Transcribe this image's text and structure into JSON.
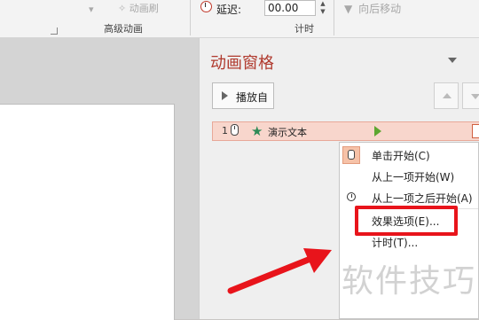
{
  "ribbon": {
    "animation_brush": "动画刷",
    "advanced_animation_group": "高级动画",
    "delay_label": "延迟:",
    "delay_value": "00.00",
    "move_later": "向后移动",
    "timing_group": "计时"
  },
  "pane": {
    "title": "动画窗格",
    "play_from": "播放自",
    "item": {
      "number": "1",
      "name": "演示文本"
    }
  },
  "context_menu": {
    "items": [
      {
        "label": "单击开始(C)",
        "icon": "mouse-icon"
      },
      {
        "label": "从上一项开始(W)",
        "icon": ""
      },
      {
        "label": "从上一项之后开始(A)",
        "icon": "clock-icon"
      },
      {
        "label": "效果选项(E)...",
        "icon": ""
      },
      {
        "label": "计时(T)...",
        "icon": ""
      }
    ]
  },
  "watermark": "软件技巧",
  "colors": {
    "accent_red": "#e8141b",
    "pane_title": "#b03a2e",
    "selected_row": "#f8d6cc"
  }
}
